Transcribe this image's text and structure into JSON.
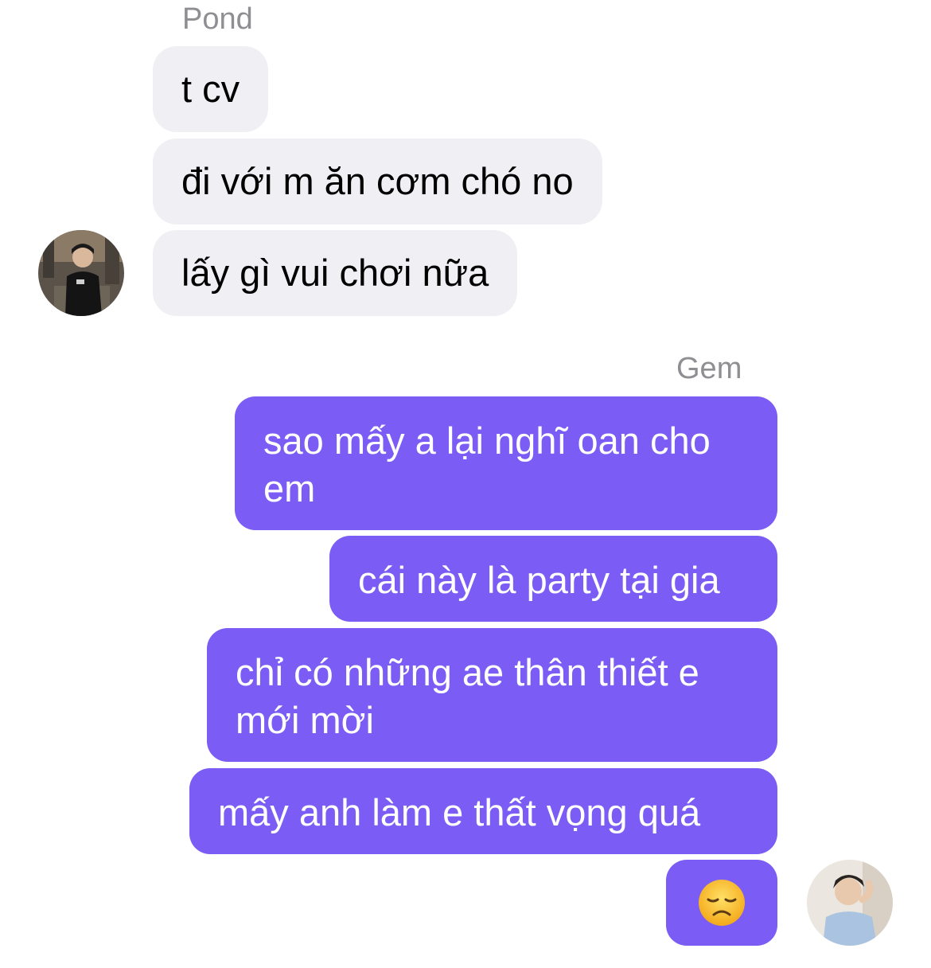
{
  "incoming": {
    "sender_name": "Pond",
    "messages": [
      "t cv",
      "đi với m ăn cơm chó no",
      "lấy gì vui chơi nữa"
    ]
  },
  "outgoing": {
    "sender_name": "Gem",
    "messages": [
      "sao mấy a lại nghĩ oan cho em",
      "cái này là party tại gia",
      "chỉ có những ae thân thiết e mới mời",
      "mấy anh làm e thất vọng quá"
    ],
    "emoji_message": "disappointed-face-emoji"
  },
  "colors": {
    "incoming_bubble": "#efeff4",
    "outgoing_bubble": "#7b5cf4",
    "sender_name": "#8e8e93"
  }
}
